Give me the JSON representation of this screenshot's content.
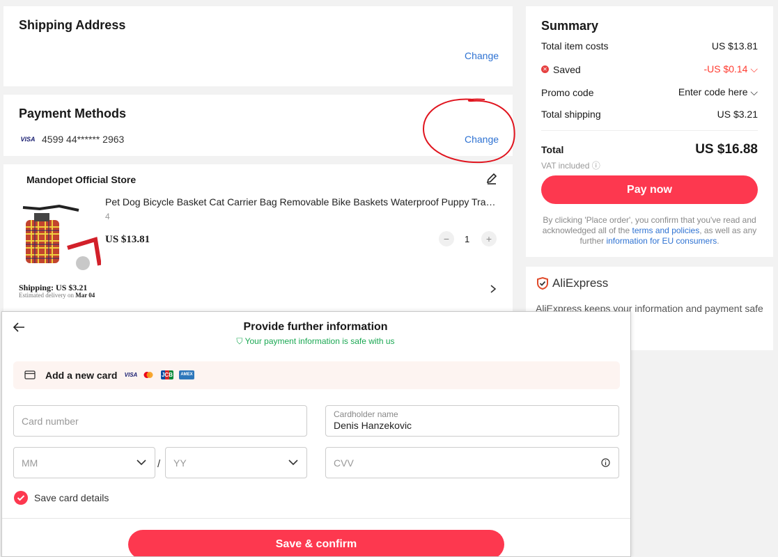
{
  "shipping": {
    "title": "Shipping Address",
    "change": "Change"
  },
  "payment": {
    "title": "Payment Methods",
    "card_brand": "VISA",
    "card_number": "4599 44****** 2963",
    "change": "Change"
  },
  "store": {
    "name": "Mandopet Official Store",
    "product_title": "Pet Dog Bicycle Basket Cat Carrier Bag Removable Bike Baskets Waterproof Puppy Travel S...",
    "variant": "4",
    "price": "US $13.81",
    "quantity": "1",
    "minus": "−",
    "plus": "+",
    "shipping": "Shipping: US $3.21",
    "delivery_prefix": "Estimated delivery on",
    "delivery_date": "Mar 04"
  },
  "summary": {
    "title": "Summary",
    "total_item_label": "Total item costs",
    "total_item_value": "US $13.81",
    "saved_label": "Saved",
    "saved_value": "-US $0.14",
    "promo_label": "Promo code",
    "promo_value": "Enter code here",
    "shipping_label": "Total shipping",
    "shipping_value": "US $3.21",
    "total_label": "Total",
    "total_value": "US $16.88",
    "vat": "VAT included",
    "pay_button": "Pay now",
    "legal_1": "By clicking 'Place order', you confirm that you've read and acknowledged all of the ",
    "legal_link1": "terms and policies",
    "legal_2": ", as well as any further ",
    "legal_link2": "information for EU consumers",
    "legal_3": "."
  },
  "aliexpress": {
    "brand": "AliExpress",
    "text": "AliExpress keeps your information and payment safe"
  },
  "modal": {
    "title": "Provide further information",
    "safe_note": "Your payment information is safe with us",
    "add_card": "Add a new card",
    "brands": [
      "VISA",
      "MC",
      "JCB",
      "AMEX"
    ],
    "card_number_placeholder": "Card number",
    "holder_label": "Cardholder name",
    "holder_value": "Denis Hanzekovic",
    "month_placeholder": "MM",
    "slash": "/",
    "year_placeholder": "YY",
    "cvv_placeholder": "CVV",
    "save_card": "Save card details",
    "confirm_button": "Save & confirm"
  },
  "colors": {
    "accent": "#fd384f",
    "link": "#2e72d2",
    "safe": "#1ba853",
    "annotation": "#e0141e"
  }
}
